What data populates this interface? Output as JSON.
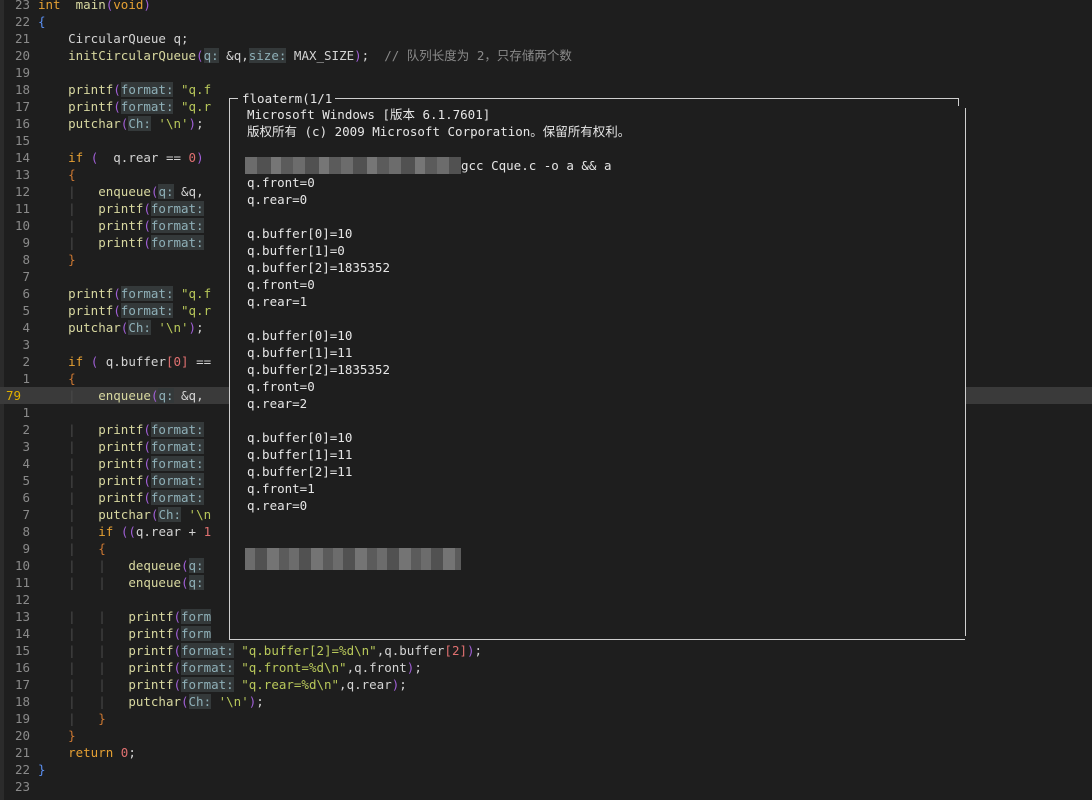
{
  "editor": {
    "lines": [
      {
        "n": "23",
        "code": [
          [
            "ty",
            "int"
          ],
          [
            "",
            "  "
          ],
          [
            "fn",
            "main"
          ],
          [
            "par",
            "("
          ],
          [
            "ty",
            "void"
          ],
          [
            "par",
            ")"
          ]
        ]
      },
      {
        "n": "22",
        "code": [
          [
            "brc",
            "{"
          ]
        ]
      },
      {
        "n": "21",
        "code": [
          [
            "",
            "    CircularQueue q;"
          ]
        ]
      },
      {
        "n": "20",
        "code": [
          [
            "",
            "    "
          ],
          [
            "fn",
            "initCircularQueue"
          ],
          [
            "par",
            "("
          ],
          [
            "hint",
            "q:"
          ],
          [
            "",
            " &q,"
          ],
          [
            "hint",
            "size:"
          ],
          [
            "",
            " MAX_SIZE"
          ],
          [
            "par",
            ")"
          ],
          [
            "",
            ";  "
          ],
          [
            "cmt",
            "// 队列长度为 2，只存储两个数"
          ]
        ]
      },
      {
        "n": "19",
        "code": []
      },
      {
        "n": "18",
        "code": [
          [
            "",
            "    "
          ],
          [
            "fn",
            "printf"
          ],
          [
            "par",
            "("
          ],
          [
            "hint",
            "format:"
          ],
          [
            "",
            ""
          ],
          [
            "str",
            " \"q.f"
          ]
        ]
      },
      {
        "n": "17",
        "code": [
          [
            "",
            "    "
          ],
          [
            "fn",
            "printf"
          ],
          [
            "par",
            "("
          ],
          [
            "hint",
            "format:"
          ],
          [
            "str",
            " \"q.r"
          ]
        ]
      },
      {
        "n": "16",
        "code": [
          [
            "",
            "    "
          ],
          [
            "fn",
            "putchar"
          ],
          [
            "par",
            "("
          ],
          [
            "hint",
            "Ch:"
          ],
          [
            "str",
            " '\\n'"
          ],
          [
            "par",
            ")"
          ],
          [
            "",
            ";"
          ]
        ]
      },
      {
        "n": "15",
        "code": []
      },
      {
        "n": "14",
        "code": [
          [
            "",
            "    "
          ],
          [
            "kw",
            "if"
          ],
          [
            "",
            " "
          ],
          [
            "par",
            "("
          ],
          [
            "",
            "  q.rear == "
          ],
          [
            "num",
            "0"
          ],
          [
            "par",
            ")"
          ]
        ]
      },
      {
        "n": "13",
        "code": [
          [
            "",
            "    "
          ],
          [
            "br2",
            "{"
          ]
        ]
      },
      {
        "n": "12",
        "code": [
          [
            "guide",
            "    |"
          ],
          [
            "",
            "   "
          ],
          [
            "fn",
            "enqueue"
          ],
          [
            "par",
            "("
          ],
          [
            "hint",
            "q:"
          ],
          [
            "",
            " &q,"
          ]
        ]
      },
      {
        "n": "11",
        "code": [
          [
            "guide",
            "    |"
          ],
          [
            "",
            "   "
          ],
          [
            "fn",
            "printf"
          ],
          [
            "par",
            "("
          ],
          [
            "hint",
            "format:"
          ]
        ]
      },
      {
        "n": "10",
        "code": [
          [
            "guide",
            "    |"
          ],
          [
            "",
            "   "
          ],
          [
            "fn",
            "printf"
          ],
          [
            "par",
            "("
          ],
          [
            "hint",
            "format:"
          ]
        ]
      },
      {
        "n": "9",
        "code": [
          [
            "guide",
            "    |"
          ],
          [
            "",
            "   "
          ],
          [
            "fn",
            "printf"
          ],
          [
            "par",
            "("
          ],
          [
            "hint",
            "format:"
          ]
        ]
      },
      {
        "n": "8",
        "code": [
          [
            "",
            "    "
          ],
          [
            "br2",
            "}"
          ]
        ]
      },
      {
        "n": "7",
        "code": []
      },
      {
        "n": "6",
        "code": [
          [
            "",
            "    "
          ],
          [
            "fn",
            "printf"
          ],
          [
            "par",
            "("
          ],
          [
            "hint",
            "format:"
          ],
          [
            "str",
            " \"q.f"
          ]
        ]
      },
      {
        "n": "5",
        "code": [
          [
            "",
            "    "
          ],
          [
            "fn",
            "printf"
          ],
          [
            "par",
            "("
          ],
          [
            "hint",
            "format:"
          ],
          [
            "str",
            " \"q.r"
          ]
        ]
      },
      {
        "n": "4",
        "code": [
          [
            "",
            "    "
          ],
          [
            "fn",
            "putchar"
          ],
          [
            "par",
            "("
          ],
          [
            "hint",
            "Ch:"
          ],
          [
            "str",
            " '\\n'"
          ],
          [
            "par",
            ")"
          ],
          [
            "",
            ";"
          ]
        ]
      },
      {
        "n": "3",
        "code": []
      },
      {
        "n": "2",
        "code": [
          [
            "",
            "    "
          ],
          [
            "kw",
            "if"
          ],
          [
            "",
            " "
          ],
          [
            "par",
            "("
          ],
          [
            "",
            "",
            " "
          ],
          [
            "",
            " q.buffer"
          ],
          [
            "idx",
            "["
          ],
          [
            "num",
            "0"
          ],
          [
            "idx",
            "]"
          ],
          [
            "",
            " =="
          ]
        ]
      },
      {
        "n": "1",
        "code": [
          [
            "",
            "    "
          ],
          [
            "br2",
            "{"
          ]
        ]
      },
      {
        "n": "79",
        "current": true,
        "code": [
          [
            "guide",
            "    |"
          ],
          [
            "",
            "   "
          ],
          [
            "fn",
            "enqueue"
          ],
          [
            "par",
            "("
          ],
          [
            "hint",
            "q:"
          ],
          [
            "",
            " &q,"
          ]
        ]
      },
      {
        "n": "1",
        "code": []
      },
      {
        "n": "2",
        "code": [
          [
            "guide",
            "    |"
          ],
          [
            "",
            "   "
          ],
          [
            "fn",
            "printf"
          ],
          [
            "par",
            "("
          ],
          [
            "hint",
            "format:"
          ]
        ]
      },
      {
        "n": "3",
        "code": [
          [
            "guide",
            "    |"
          ],
          [
            "",
            "   "
          ],
          [
            "fn",
            "printf"
          ],
          [
            "par",
            "("
          ],
          [
            "hint",
            "format:"
          ]
        ]
      },
      {
        "n": "4",
        "code": [
          [
            "guide",
            "    |"
          ],
          [
            "",
            "   "
          ],
          [
            "fn",
            "printf"
          ],
          [
            "par",
            "("
          ],
          [
            "hint",
            "format:"
          ]
        ]
      },
      {
        "n": "5",
        "code": [
          [
            "guide",
            "    |"
          ],
          [
            "",
            "   "
          ],
          [
            "fn",
            "printf"
          ],
          [
            "par",
            "("
          ],
          [
            "hint",
            "format:"
          ]
        ]
      },
      {
        "n": "6",
        "code": [
          [
            "guide",
            "    |"
          ],
          [
            "",
            "   "
          ],
          [
            "fn",
            "printf"
          ],
          [
            "par",
            "("
          ],
          [
            "hint",
            "format:"
          ]
        ]
      },
      {
        "n": "7",
        "code": [
          [
            "guide",
            "    |"
          ],
          [
            "",
            "   "
          ],
          [
            "fn",
            "putchar"
          ],
          [
            "par",
            "("
          ],
          [
            "hint",
            "Ch:"
          ],
          [
            "str",
            " '\\n"
          ]
        ]
      },
      {
        "n": "8",
        "code": [
          [
            "guide",
            "    |"
          ],
          [
            "",
            "   "
          ],
          [
            "kw",
            "if"
          ],
          [
            "",
            " "
          ],
          [
            "par",
            "(("
          ],
          [
            "",
            "q.rear + "
          ],
          [
            "num",
            "1"
          ]
        ]
      },
      {
        "n": "9",
        "code": [
          [
            "guide",
            "    |"
          ],
          [
            "",
            "   "
          ],
          [
            "br2",
            "{"
          ]
        ]
      },
      {
        "n": "10",
        "code": [
          [
            "guide",
            "    |   |"
          ],
          [
            "",
            "   "
          ],
          [
            "fn",
            "dequeue"
          ],
          [
            "par",
            "("
          ],
          [
            "hint",
            "q:"
          ]
        ]
      },
      {
        "n": "11",
        "code": [
          [
            "guide",
            "    |   |"
          ],
          [
            "",
            "   "
          ],
          [
            "fn",
            "enqueue"
          ],
          [
            "par",
            "("
          ],
          [
            "hint",
            "q:"
          ]
        ]
      },
      {
        "n": "12",
        "code": []
      },
      {
        "n": "13",
        "code": [
          [
            "guide",
            "    |   |"
          ],
          [
            "",
            "   "
          ],
          [
            "fn",
            "printf"
          ],
          [
            "par",
            "("
          ],
          [
            "hint",
            "form"
          ]
        ]
      },
      {
        "n": "14",
        "code": [
          [
            "guide",
            "    |   |"
          ],
          [
            "",
            "   "
          ],
          [
            "fn",
            "printf"
          ],
          [
            "par",
            "("
          ],
          [
            "hint",
            "form"
          ]
        ]
      },
      {
        "n": "15",
        "code": [
          [
            "guide",
            "    |   |"
          ],
          [
            "",
            "   "
          ],
          [
            "fn",
            "printf"
          ],
          [
            "par",
            "("
          ],
          [
            "hint",
            "format:"
          ],
          [
            "str",
            " \"q.buffer[2]=%d\\n\""
          ],
          [
            "",
            ",q.buffer"
          ],
          [
            "idx",
            "["
          ],
          [
            "num",
            "2"
          ],
          [
            "idx",
            "]"
          ],
          [
            "par",
            ")"
          ],
          [
            "",
            ";"
          ]
        ]
      },
      {
        "n": "16",
        "code": [
          [
            "guide",
            "    |   |"
          ],
          [
            "",
            "   "
          ],
          [
            "fn",
            "printf"
          ],
          [
            "par",
            "("
          ],
          [
            "hint",
            "format:"
          ],
          [
            "str",
            " \"q.front=%d\\n\""
          ],
          [
            "",
            ",q.front"
          ],
          [
            "par",
            ")"
          ],
          [
            "",
            ";"
          ]
        ]
      },
      {
        "n": "17",
        "code": [
          [
            "guide",
            "    |   |"
          ],
          [
            "",
            "   "
          ],
          [
            "fn",
            "printf"
          ],
          [
            "par",
            "("
          ],
          [
            "hint",
            "format:"
          ],
          [
            "str",
            " \"q.rear=%d\\n\""
          ],
          [
            "",
            ",q.rear"
          ],
          [
            "par",
            ")"
          ],
          [
            "",
            ";"
          ]
        ]
      },
      {
        "n": "18",
        "code": [
          [
            "guide",
            "    |   |"
          ],
          [
            "",
            "   "
          ],
          [
            "fn",
            "putchar"
          ],
          [
            "par",
            "("
          ],
          [
            "hint",
            "Ch:"
          ],
          [
            "str",
            " '\\n'"
          ],
          [
            "par",
            ")"
          ],
          [
            "",
            ";"
          ]
        ]
      },
      {
        "n": "19",
        "code": [
          [
            "guide",
            "    |"
          ],
          [
            "",
            "   "
          ],
          [
            "br2",
            "}"
          ]
        ]
      },
      {
        "n": "20",
        "code": [
          [
            "",
            "    "
          ],
          [
            "br2",
            "}"
          ]
        ]
      },
      {
        "n": "21",
        "code": [
          [
            "",
            "    "
          ],
          [
            "kw",
            "return"
          ],
          [
            "",
            " "
          ],
          [
            "num",
            "0"
          ],
          [
            "",
            ";"
          ]
        ]
      },
      {
        "n": "22",
        "code": [
          [
            "brc",
            "}"
          ]
        ]
      },
      {
        "n": "23",
        "code": []
      }
    ]
  },
  "terminal": {
    "title": "floaterm(1/1",
    "lines": [
      "Microsoft Windows [版本 6.1.7601]",
      "版权所有 (c) 2009 Microsoft Corporation。保留所有权利。",
      "",
      {
        "blur": 216,
        "text": "gcc Cque.c -o a && a"
      },
      "q.front=0",
      "q.rear=0",
      "",
      "q.buffer[0]=10",
      "q.buffer[1]=0",
      "q.buffer[2]=1835352",
      "q.front=0",
      "q.rear=1",
      "",
      "q.buffer[0]=10",
      "q.buffer[1]=11",
      "q.buffer[2]=1835352",
      "q.front=0",
      "q.rear=2",
      "",
      "q.buffer[0]=10",
      "q.buffer[1]=11",
      "q.buffer[2]=11",
      "q.front=1",
      "q.rear=0",
      "",
      "",
      {
        "blur2": 216
      }
    ]
  }
}
